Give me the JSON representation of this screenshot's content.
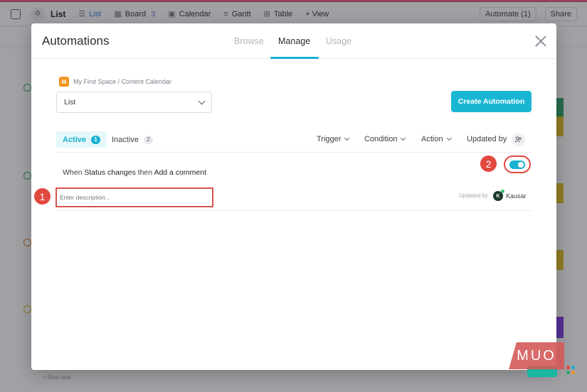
{
  "app": {
    "title": "List",
    "views": [
      {
        "label": "List",
        "active": true,
        "count": ""
      },
      {
        "label": "Board",
        "active": false,
        "count": "3"
      },
      {
        "label": "Calendar",
        "active": false,
        "count": ""
      },
      {
        "label": "Gantt",
        "active": false,
        "count": ""
      },
      {
        "label": "Table",
        "active": false,
        "count": ""
      }
    ],
    "add_view": "+ View",
    "automate": "Automate (1)",
    "share": "Share",
    "new_task": "+ New task"
  },
  "modal": {
    "title": "Automations",
    "tabs": [
      {
        "label": "Browse",
        "active": false
      },
      {
        "label": "Manage",
        "active": true
      },
      {
        "label": "Usage",
        "active": false
      }
    ],
    "breadcrumb": {
      "space_initial": "M",
      "path": "My First Space / Content Calendar"
    },
    "location_select": "List",
    "create_button": "Create Automation",
    "status_tabs": {
      "active_label": "Active",
      "active_count": "1",
      "inactive_label": "Inactive",
      "inactive_count": "2"
    },
    "filters": {
      "trigger": "Trigger",
      "condition": "Condition",
      "action": "Action",
      "updated_by": "Updated by"
    },
    "automation": {
      "when": "When",
      "trigger": "Status changes",
      "then": "then",
      "action": "Add a comment",
      "enabled": true,
      "description_placeholder": "Enter description...",
      "updated_by_label": "Updated by",
      "user_initial": "K",
      "user_name": "Kausar"
    }
  },
  "callouts": {
    "one": "1",
    "two": "2"
  },
  "watermark": "MUO",
  "colors": {
    "accent": "#19b2d1",
    "callout": "#e1493f",
    "space_badge": "#f2951e"
  }
}
